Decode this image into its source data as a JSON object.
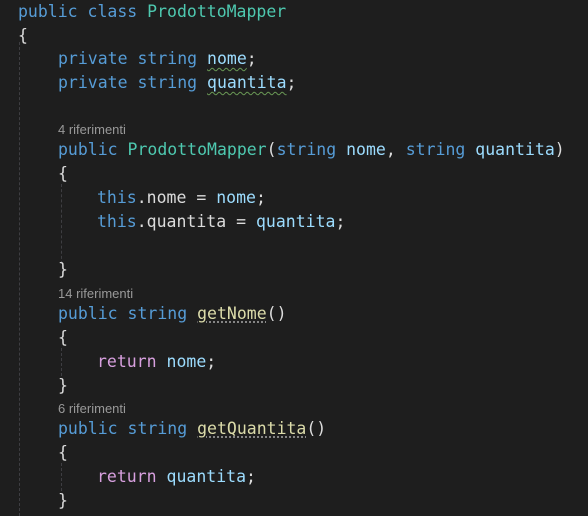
{
  "editor": {
    "lines": {
      "class_decl": {
        "kw1": "public",
        "kw2": "class",
        "name": "ProdottoMapper"
      },
      "open_brace": "{",
      "field1": {
        "kw": "private",
        "type": "string",
        "name": "nome",
        "semi": ";"
      },
      "field2": {
        "kw": "private",
        "type": "string",
        "name": "quantita",
        "semi": ";"
      },
      "ctor": {
        "kw": "public",
        "name": "ProdottoMapper",
        "open": "(",
        "t1": "string",
        "p1": "nome",
        "comma": ", ",
        "t2": "string",
        "p2": "quantita",
        "close": ")"
      },
      "ctor_open": "{",
      "assign1": {
        "this": "this",
        "rest": ".nome = ",
        "val": "nome",
        "semi": ";"
      },
      "assign2": {
        "this": "this",
        "rest": ".quantita = ",
        "val": "quantita",
        "semi": ";"
      },
      "ctor_close": "}",
      "m1": {
        "kw": "public",
        "type": "string",
        "name": "getNome",
        "parens": "()"
      },
      "m1_open": "{",
      "m1_ret": {
        "kw": "return",
        "val": "nome",
        "semi": ";"
      },
      "m1_close": "}",
      "m2": {
        "kw": "public",
        "type": "string",
        "name": "getQuantita",
        "parens": "()"
      },
      "m2_open": "{",
      "m2_ret": {
        "kw": "return",
        "val": "quantita",
        "semi": ";"
      },
      "m2_close": "}"
    },
    "codelens": {
      "ctor": "4 riferimenti",
      "getNome": "14 riferimenti",
      "getQuantita": "6 riferimenti"
    }
  },
  "colors": {
    "background": "#1e1e1e",
    "keyword": "#569cd6",
    "control_keyword": "#d8a0df",
    "type": "#4ec9b0",
    "method": "#dcdcaa",
    "identifier": "#dcdcdc",
    "parameter": "#9cdcfe",
    "codelens": "#999999"
  }
}
